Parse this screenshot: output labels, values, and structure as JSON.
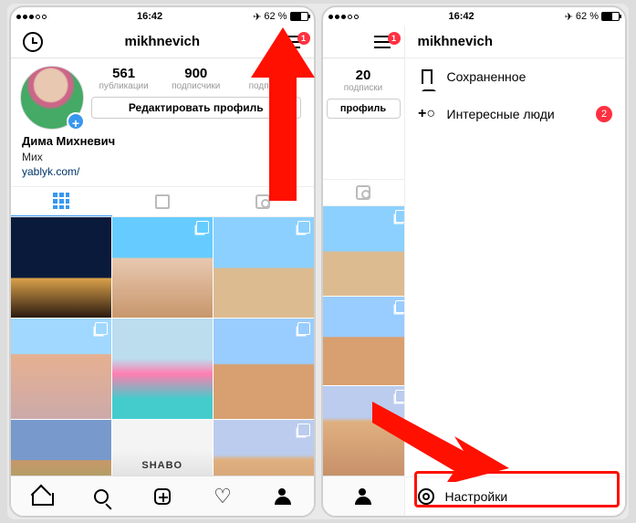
{
  "status": {
    "time": "16:42",
    "battery_pct": "62 %",
    "signal_filled": 3
  },
  "left": {
    "username": "mikhnevich",
    "menu_badge": "1",
    "stats": [
      {
        "num": "561",
        "lbl": "публикации"
      },
      {
        "num": "900",
        "lbl": "подписчики"
      },
      {
        "num": "20",
        "lbl": "подписки"
      }
    ],
    "edit_label": "Редактировать профиль",
    "display_name": "Дима Михневич",
    "bio": "Мих",
    "link": "yablyk.com/",
    "photo_overlay_text": "SHABO",
    "photos_multi": [
      false,
      true,
      true,
      true,
      false,
      true,
      false,
      false,
      true
    ]
  },
  "right": {
    "menu_badge": "1",
    "peek_stat": {
      "num": "20",
      "lbl": "подписки"
    },
    "peek_edit": "профиль",
    "username": "mikhnevich",
    "items": [
      {
        "icon": "bookmark",
        "label": "Сохраненное",
        "badge": null
      },
      {
        "icon": "add-person",
        "label": "Интересные люди",
        "badge": "2"
      }
    ],
    "settings_label": "Настройки"
  }
}
